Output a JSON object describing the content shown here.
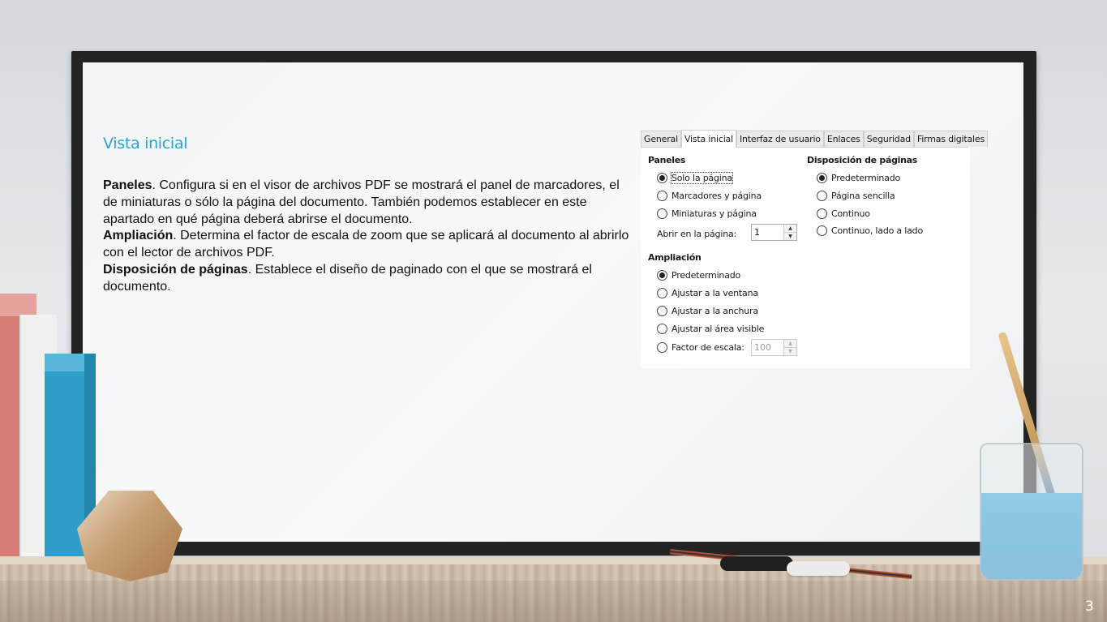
{
  "slide": {
    "title": "Vista inicial",
    "page_number": "3",
    "paragraphs": [
      {
        "heading": "Paneles",
        "text": ".  Configura si en el visor de archivos PDF se mostrará el panel de marcadores, el de miniaturas o sólo la página del documento.   También podemos establecer en este apartado en qué página deberá abrirse el documento."
      },
      {
        "heading": "Ampliación",
        "text": ".  Determina el factor de escala de zoom que se aplicará al documento al abrirlo con el lector de archivos PDF."
      },
      {
        "heading": "Disposición de páginas",
        "text": ".  Establece el diseño de paginado con el que se mostrará el documento."
      }
    ]
  },
  "dialog": {
    "tabs": [
      "General",
      "Vista inicial",
      "Interfaz de usuario",
      "Enlaces",
      "Seguridad",
      "Firmas digitales"
    ],
    "active_tab": "Vista inicial",
    "panels": {
      "label": "Paneles",
      "options": [
        "Solo la página",
        "Marcadores y página",
        "Miniaturas y página"
      ],
      "selected": "Solo la página",
      "open_page_label": "Abrir en la página:",
      "open_page_value": "1"
    },
    "zoom": {
      "label": "Ampliación",
      "options": [
        "Predeterminado",
        "Ajustar a la ventana",
        "Ajustar a la anchura",
        "Ajustar al área visible",
        "Factor de escala:"
      ],
      "selected": "Predeterminado",
      "scale_value": "100"
    },
    "layout": {
      "label": "Disposición de páginas",
      "options": [
        "Predeterminado",
        "Página sencilla",
        "Continuo",
        "Continuo, lado a lado"
      ],
      "selected": "Predeterminado"
    }
  }
}
